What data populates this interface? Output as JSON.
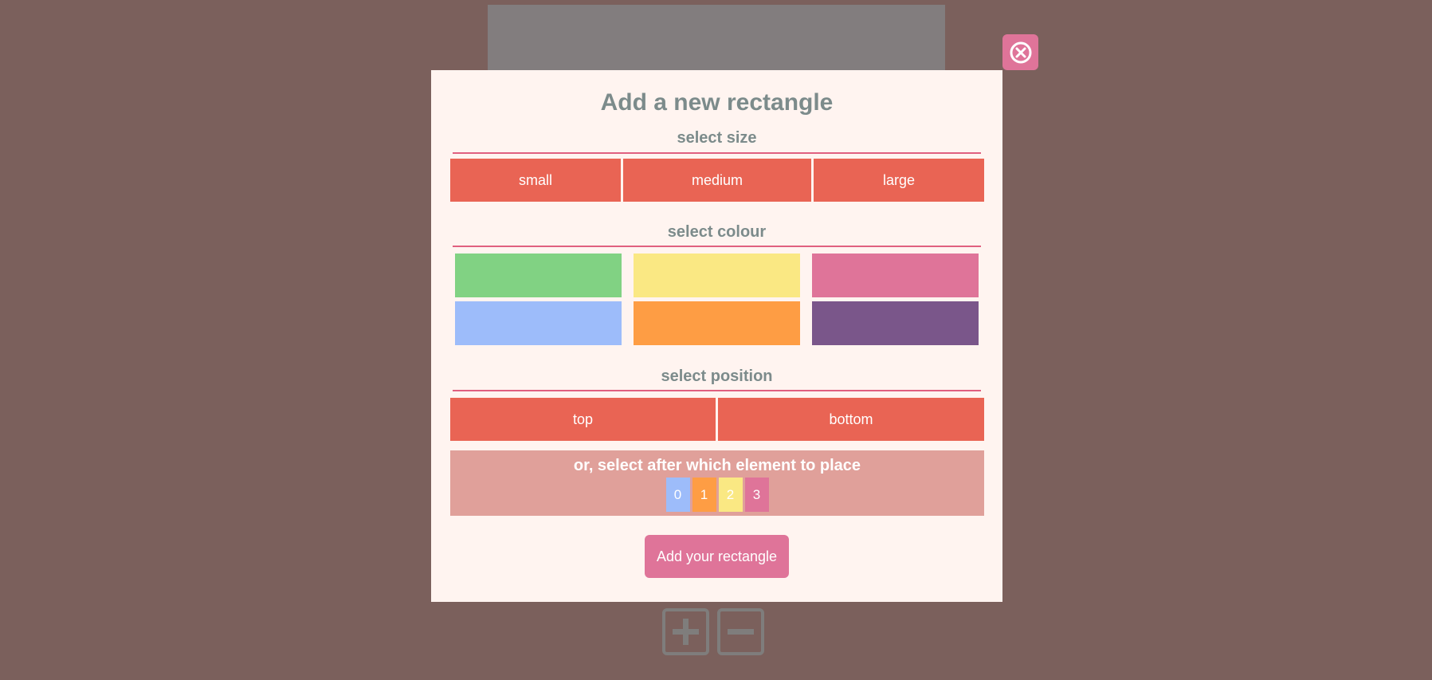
{
  "modal": {
    "title": "Add a new rectangle",
    "close_icon": "close-circle-icon",
    "size": {
      "label": "select size",
      "options": [
        "small",
        "medium",
        "large"
      ]
    },
    "colour": {
      "label": "select colour",
      "swatches": [
        "#81d283",
        "#fae883",
        "#df7499",
        "#9dbcfa",
        "#fe9d44",
        "#7a568a"
      ]
    },
    "position": {
      "label": "select position",
      "options": [
        "top",
        "bottom"
      ]
    },
    "after": {
      "label": "or, select after which element to place",
      "elements": [
        {
          "label": "0",
          "color": "#9dbcfa"
        },
        {
          "label": "1",
          "color": "#fe9d44"
        },
        {
          "label": "2",
          "color": "#fae883"
        },
        {
          "label": "3",
          "color": "#df7499"
        }
      ]
    },
    "submit_label": "Add your rectangle"
  },
  "controls": {
    "plus_icon": "plus-square-icon",
    "minus_icon": "minus-square-icon"
  },
  "colors": {
    "background": "#7b605c",
    "modal_bg": "#fff4f0",
    "button": "#e96454",
    "accent": "#df7499",
    "heading": "#7c8b8b"
  }
}
